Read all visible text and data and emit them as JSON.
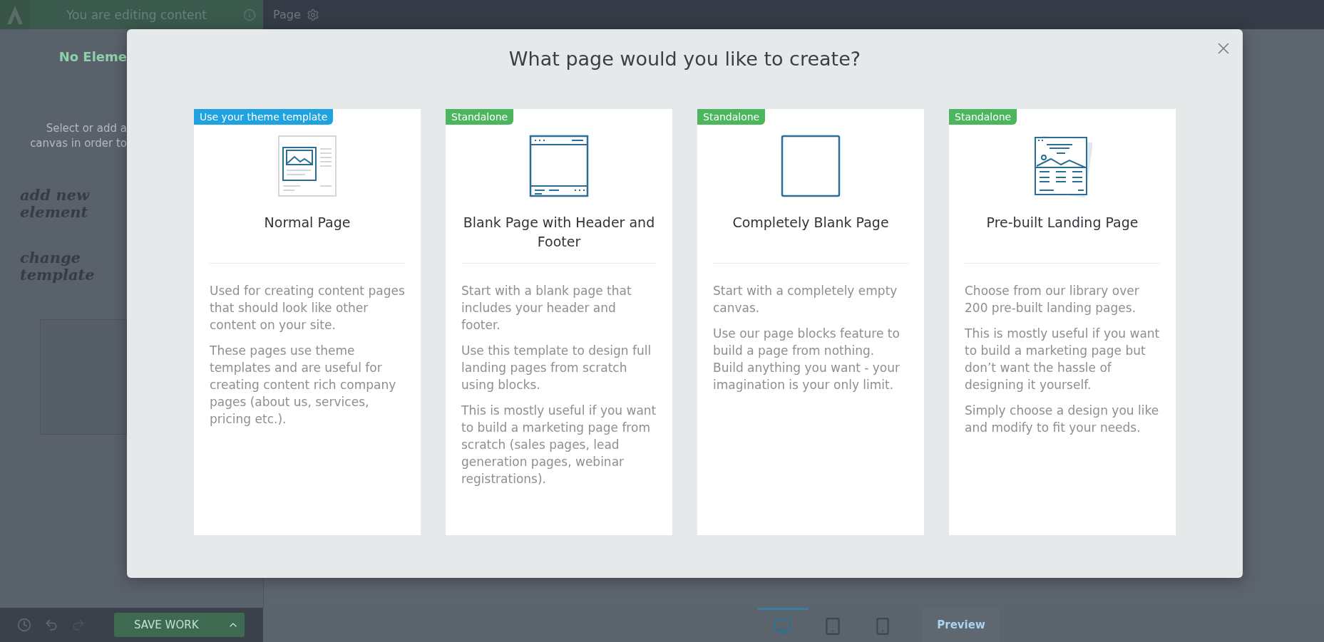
{
  "top_bar": {
    "mode_label": "You are editing content",
    "page_label": "Page"
  },
  "sidebar": {
    "heading": "No Eleme",
    "hint_lines": [
      "Select or add a",
      "canvas in order to"
    ],
    "notes": [
      "add new element",
      "change template"
    ]
  },
  "modal": {
    "title": "What page would you like to create?",
    "cards": [
      {
        "kind": "normal",
        "badge": {
          "text": "Use your theme template",
          "color": "#1fa3e0"
        },
        "title": "Normal Page",
        "paragraphs": [
          "Used for creating content pages that should look like other content on your site.",
          "These pages use theme templates and are useful for creating content rich company pages (about us, services, pricing etc.)."
        ]
      },
      {
        "kind": "header_footer",
        "badge": {
          "text": "Standalone",
          "color": "#4cb65e"
        },
        "title": "Blank Page with Header and Footer",
        "paragraphs": [
          "Start with a blank page that includes your header and footer.",
          "Use this template to design full landing pages from scratch using blocks.",
          "This is mostly useful if you want to build a marketing page from scratch (sales pages, lead generation pages, webinar registrations)."
        ]
      },
      {
        "kind": "blank",
        "badge": {
          "text": "Standalone",
          "color": "#4cb65e"
        },
        "title": "Completely Blank Page",
        "paragraphs": [
          "Start with a completely empty canvas.",
          "Use our page blocks feature to build a page from nothing. Build anything you want - your imagination is your only limit."
        ]
      },
      {
        "kind": "landing",
        "badge": {
          "text": "Standalone",
          "color": "#4cb65e"
        },
        "title": "Pre-built Landing Page",
        "paragraphs": [
          "Choose from our library over 200 pre-built landing pages.",
          "This is mostly useful if you want to build a marketing page but don’t want the hassle of designing it yourself.",
          "Simply choose a design you like and modify to fit your needs."
        ]
      }
    ]
  },
  "bottom_bar": {
    "save_label": "SAVE WORK",
    "devices": [
      {
        "kind": "desktop",
        "selected": true
      },
      {
        "kind": "tablet",
        "selected": false
      },
      {
        "kind": "mobile",
        "selected": false
      }
    ],
    "preview_label": "Preview"
  }
}
